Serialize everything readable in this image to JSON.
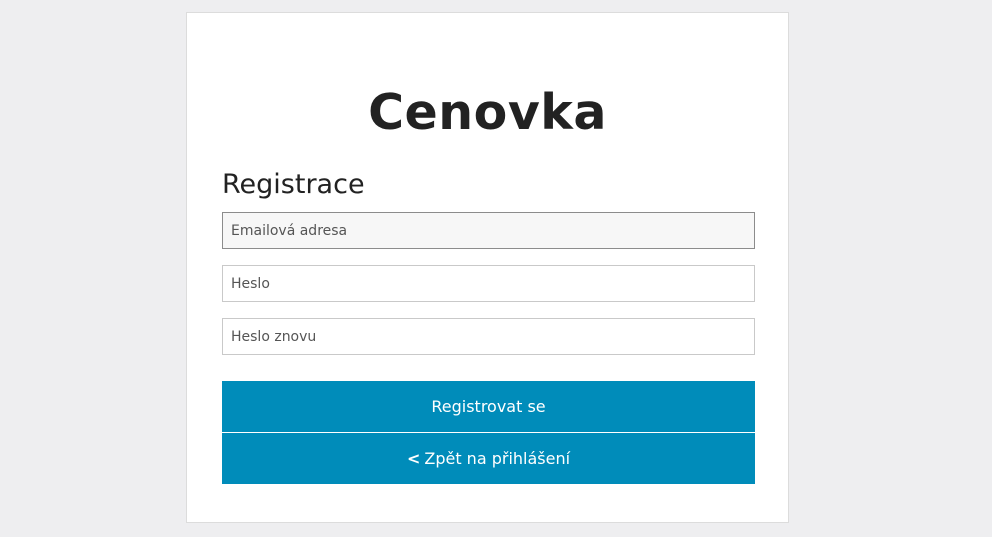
{
  "app": {
    "title": "Cenovka"
  },
  "form": {
    "heading": "Registrace",
    "email": {
      "placeholder": "Emailová adresa",
      "value": ""
    },
    "password": {
      "placeholder": "Heslo",
      "value": ""
    },
    "password_repeat": {
      "placeholder": "Heslo znovu",
      "value": ""
    },
    "register_label": "Registrovat se",
    "back_chevron": "<",
    "back_label": "Zpět na přihlášení"
  },
  "colors": {
    "accent": "#008cba",
    "page_background": "#eeeef0",
    "card_background": "#ffffff"
  }
}
